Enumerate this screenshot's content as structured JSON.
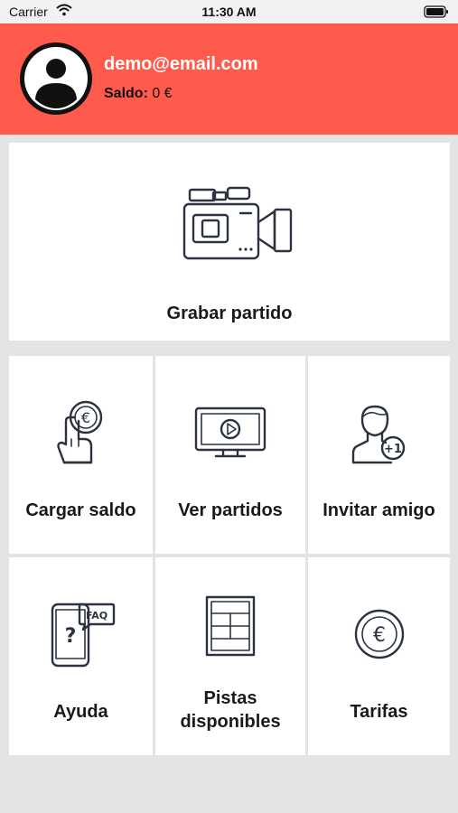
{
  "status_bar": {
    "carrier": "Carrier",
    "time": "11:30 AM"
  },
  "profile": {
    "email": "demo@email.com",
    "balance_label": "Saldo:",
    "balance_value": " 0 €"
  },
  "menu": {
    "record": "Grabar partido",
    "load_balance": "Cargar saldo",
    "watch_matches": "Ver partidos",
    "invite_friend": "Invitar amigo",
    "help": "Ayuda",
    "courts_line1": "Pistas",
    "courts_line2": "disponibles",
    "rates": "Tarifas"
  },
  "icons": {
    "record": "video-camera-icon",
    "load_balance": "hand-coin-icon",
    "watch_matches": "tv-play-icon",
    "invite_friend": "user-plus-one-icon",
    "help": "phone-faq-icon",
    "courts": "court-icon",
    "rates": "euro-coin-icon"
  },
  "icon_glyphs": {
    "euro": "€",
    "faq": "FAQ",
    "question": "?",
    "plus_one": "+1"
  },
  "colors": {
    "header": "#ff5b4d",
    "background": "#e4e4e4",
    "tile": "#ffffff",
    "icon": "#2b3340"
  }
}
